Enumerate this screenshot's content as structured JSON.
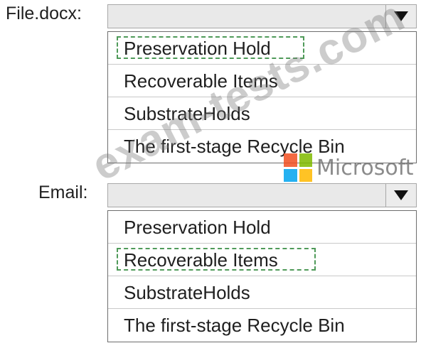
{
  "file_row": {
    "label": "File.docx:",
    "selected_value": "",
    "options": [
      {
        "label": "Preservation Hold",
        "highlighted": true
      },
      {
        "label": "Recoverable Items",
        "highlighted": false
      },
      {
        "label": "SubstrateHolds",
        "highlighted": false
      },
      {
        "label": "The first-stage Recycle Bin",
        "highlighted": false
      }
    ]
  },
  "email_row": {
    "label": "Email:",
    "selected_value": "",
    "options": [
      {
        "label": "Preservation Hold",
        "highlighted": false
      },
      {
        "label": "Recoverable Items",
        "highlighted": true
      },
      {
        "label": "SubstrateHolds",
        "highlighted": false
      },
      {
        "label": "The first-stage Recycle Bin",
        "highlighted": false
      }
    ]
  },
  "icons": {
    "dropdown_arrow": "triangle-down-icon",
    "brand_logo": "microsoft-logo-icon"
  },
  "colors": {
    "highlight_border": "#4f9a59",
    "combo_background": "#e9e9e9",
    "logo": [
      "#f25022",
      "#7fba00",
      "#00a4ef",
      "#ffb900"
    ]
  },
  "watermark": {
    "text": "exam-tests.com",
    "brand": "Microsoft"
  }
}
